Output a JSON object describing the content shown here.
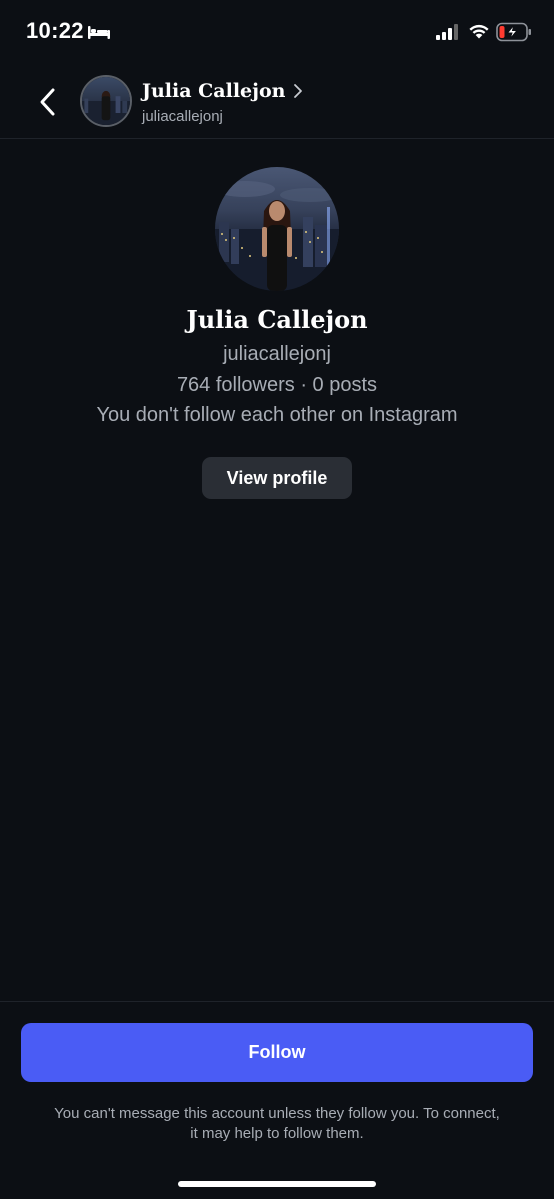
{
  "status_bar": {
    "time": "10:22",
    "icons": [
      "bed-icon",
      "signal-icon",
      "wifi-icon",
      "battery-charging-icon"
    ]
  },
  "header": {
    "back_icon": "chevron-left-icon",
    "name": "Julia Callejon",
    "chevron_icon": "chevron-right-icon",
    "username": "juliacallejonj"
  },
  "profile": {
    "name": "Julia Callejon",
    "username": "juliacallejonj",
    "stats": "764 followers · 0 posts",
    "relation": "You don't follow each other on Instagram",
    "view_profile_label": "View profile"
  },
  "footer": {
    "follow_label": "Follow",
    "note": "You can't message this account unless they follow you. To connect, it may help to follow them."
  },
  "colors": {
    "background": "#0c0f14",
    "accent": "#4a5cf5",
    "secondary_text": "#a8adb5",
    "button_dark": "#2a2e35",
    "battery_low": "#ff3b30"
  }
}
